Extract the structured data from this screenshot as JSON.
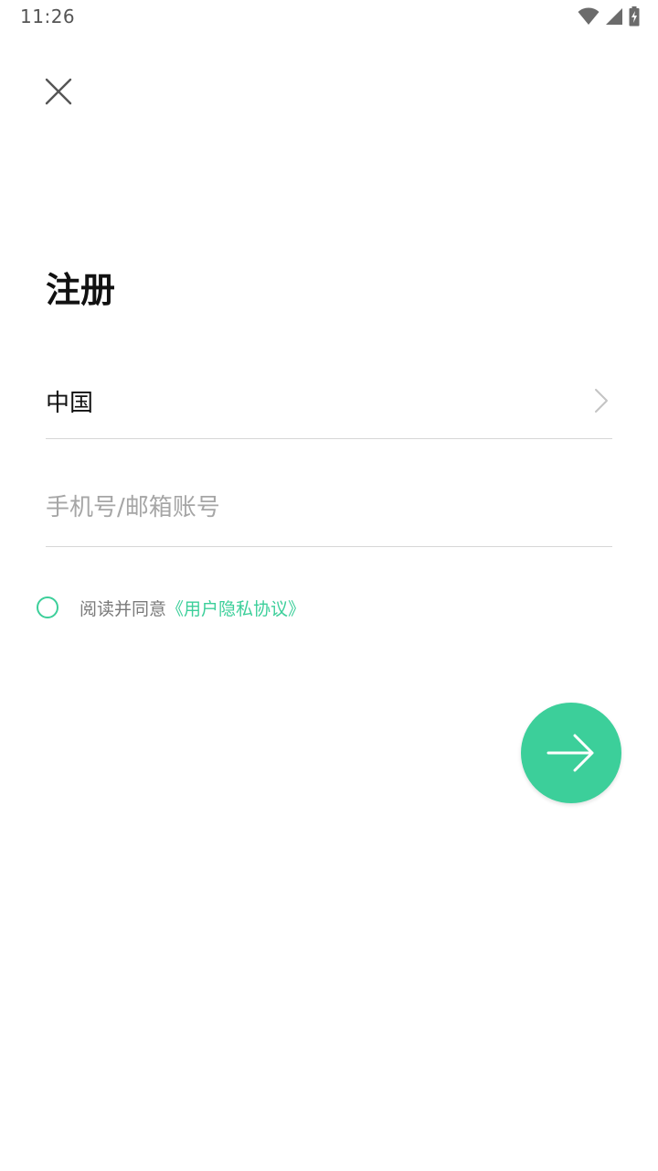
{
  "status_bar": {
    "time": "11:26",
    "icons": [
      "wifi-icon",
      "cellular-signal-icon",
      "battery-charging-icon"
    ]
  },
  "close_icon": "close-icon",
  "title": "注册",
  "country": {
    "value": "中国",
    "icon": "chevron-right-icon"
  },
  "account": {
    "value": "",
    "placeholder": "手机号/邮箱账号"
  },
  "agreement": {
    "checked": false,
    "text": "阅读并同意",
    "link": "《用户隐私协议》"
  },
  "next_button": {
    "icon": "arrow-right-icon"
  },
  "colors": {
    "accent": "#3ccf9a",
    "text_primary": "#111111",
    "text_secondary": "#7a7a7a",
    "placeholder": "#a6a6a6",
    "divider": "#d6d6d6"
  }
}
